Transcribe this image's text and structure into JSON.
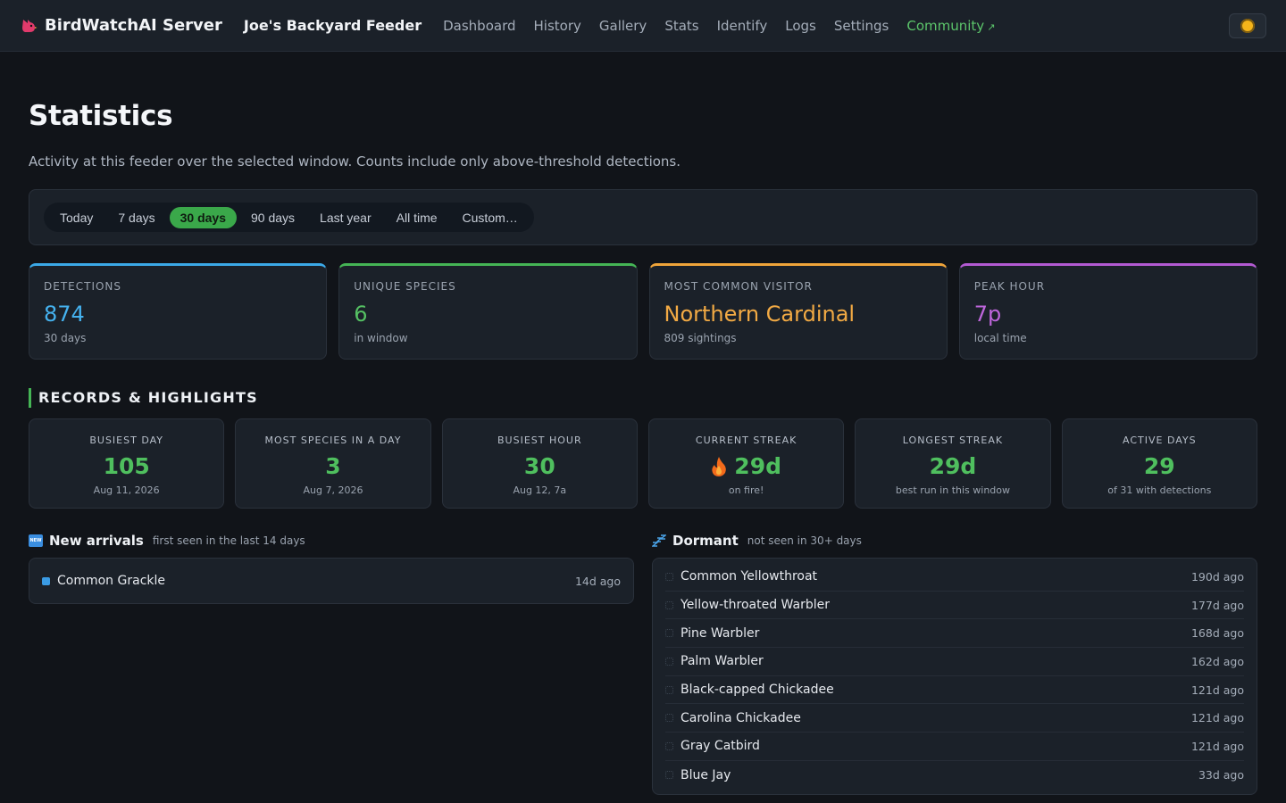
{
  "nav": {
    "brand": "BirdWatchAI Server",
    "feeder": "Joe's Backyard Feeder",
    "links": [
      "Dashboard",
      "History",
      "Gallery",
      "Stats",
      "Identify",
      "Logs",
      "Settings"
    ],
    "community": "Community",
    "community_icon": "external-link-icon",
    "theme_icon": "sun-icon"
  },
  "page": {
    "title": "Statistics",
    "subtitle": "Activity at this feeder over the selected window. Counts include only above-threshold detections."
  },
  "ranges": {
    "options": [
      "Today",
      "7 days",
      "30 days",
      "90 days",
      "Last year",
      "All time",
      "Custom…"
    ],
    "selected": "30 days"
  },
  "stats": [
    {
      "label": "Detections",
      "value": "874",
      "sub": "30 days",
      "color": "#45b2ef"
    },
    {
      "label": "Unique species",
      "value": "6",
      "sub": "in window",
      "color": "#55c163"
    },
    {
      "label": "Most common visitor",
      "value": "Northern Cardinal",
      "sub": "809 sightings",
      "color": "#f2aa44"
    },
    {
      "label": "Peak hour",
      "value": "7p",
      "sub": "local time",
      "color": "#be66db"
    }
  ],
  "records": {
    "title": "Records & Highlights",
    "items": [
      {
        "label": "Busiest day",
        "value": "105",
        "sub": "Aug 11, 2026"
      },
      {
        "label": "Most species in a day",
        "value": "3",
        "sub": "Aug 7, 2026"
      },
      {
        "label": "Busiest hour",
        "value": "30",
        "sub": "Aug 12, 7a"
      },
      {
        "label": "Current streak",
        "value": "29d",
        "sub": "on fire!",
        "icon": "flame-icon"
      },
      {
        "label": "Longest streak",
        "value": "29d",
        "sub": "best run in this window"
      },
      {
        "label": "Active days",
        "value": "29",
        "sub": "of 31 with detections"
      }
    ]
  },
  "new_arrivals": {
    "title": "New arrivals",
    "note": "first seen in the last 14 days",
    "icon_text": "NEW",
    "items": [
      {
        "name": "Common Grackle",
        "ago": "14d ago"
      }
    ]
  },
  "dormant": {
    "title": "Dormant",
    "note": "not seen in 30+ days",
    "icon": "zzz-icon",
    "items": [
      {
        "name": "Common Yellowthroat",
        "ago": "190d ago"
      },
      {
        "name": "Yellow-throated Warbler",
        "ago": "177d ago"
      },
      {
        "name": "Pine Warbler",
        "ago": "168d ago"
      },
      {
        "name": "Palm Warbler",
        "ago": "162d ago"
      },
      {
        "name": "Black-capped Chickadee",
        "ago": "121d ago"
      },
      {
        "name": "Carolina Chickadee",
        "ago": "121d ago"
      },
      {
        "name": "Gray Catbird",
        "ago": "121d ago"
      },
      {
        "name": "Blue Jay",
        "ago": "33d ago"
      }
    ]
  }
}
